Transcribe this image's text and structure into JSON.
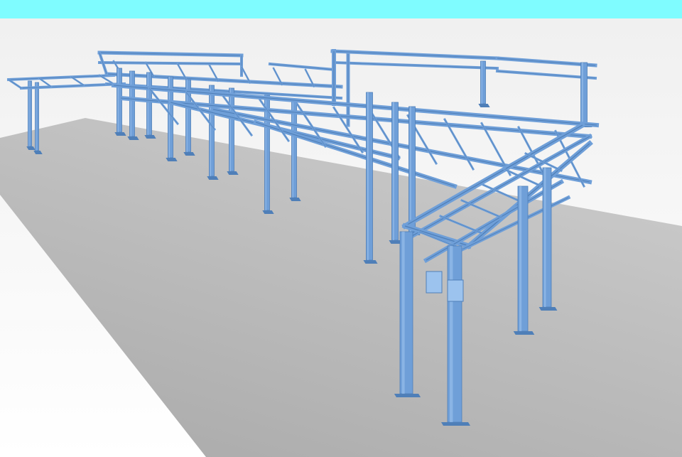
{
  "header": {
    "bar_color": "#7ffcff"
  },
  "viewport": {
    "background_top": "#f0f0f0",
    "background_bottom": "#ffffff",
    "ground_color_near": "#a9a9a9",
    "ground_color_far": "#c9c9c9",
    "steel_color": "#6f9fd8",
    "steel_shade": "#4f7fb8",
    "steel_highlight": "#9cc3ee",
    "model": "steel-pipe-rack-structure"
  }
}
